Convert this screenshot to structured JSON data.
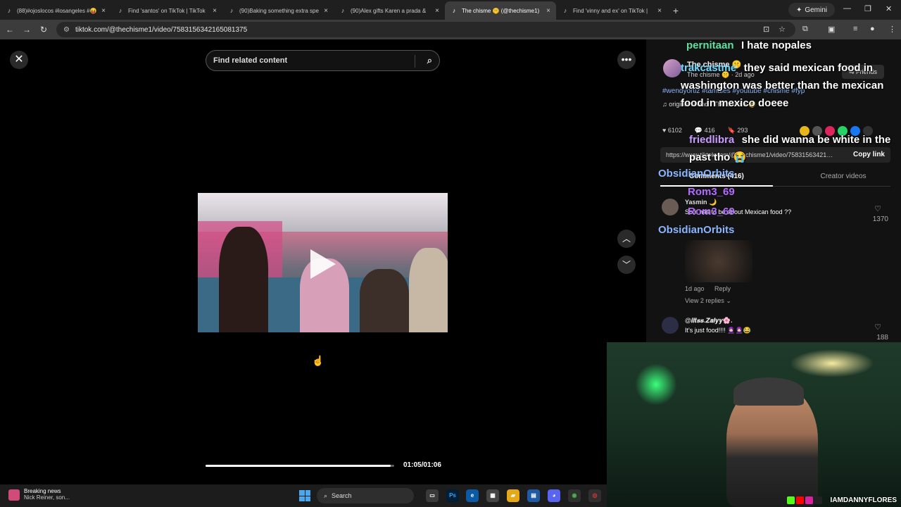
{
  "browser": {
    "tabs": [
      {
        "title": "(88)#ojoslocos #losangeles #😝",
        "active": false
      },
      {
        "title": "Find 'santos' on TikTok | TikTok",
        "active": false
      },
      {
        "title": "(90)Baking something extra spe",
        "active": false
      },
      {
        "title": "(90)Alex gifts Karen a prada &",
        "active": false
      },
      {
        "title": "The chisme 🤫 (@thechisme1)",
        "active": true
      },
      {
        "title": "Find 'vinny and ex' on TikTok |",
        "active": false
      }
    ],
    "new_tab": "+",
    "gemini_label": "Gemini",
    "url": "tiktok.com/@thechisme1/video/7583156342165081375"
  },
  "video": {
    "search_placeholder": "Find related content",
    "progress_percent": 98,
    "time": "01:05/01:06"
  },
  "post": {
    "author": "The chisme 🤫",
    "age": "2d ago",
    "friends_label": "Friends",
    "hashtags": "#wendyortiz #tamales #youtube #chisme #fyp",
    "sound": "original sound - The chisme 🤫",
    "likes": "6102",
    "comments": "416",
    "saves": "293",
    "link": "https://www.tiktok.com/@thechisme1/video/7583156342165081375",
    "copy_link": "Copy link",
    "tab_comments": "Comments (416)",
    "tab_creator": "Creator videos"
  },
  "comments": [
    {
      "user": "Yasmin 🌙",
      "text": "So it has to be about Mexican food ??",
      "likes": "1370",
      "age": "1d ago",
      "reply": "Reply",
      "view_replies": "View 2 replies"
    },
    {
      "user": "@𝒊𝒊𝒕𝒔𝒔.𝒁𝒂𝒍𝒚𝒚🌸.",
      "text": "It's just food!!!! 🧕🏻🧕🏻😂",
      "likes": "188"
    }
  ],
  "overlay_chat": [
    {
      "name": "pernitaan",
      "msg": "I hate nopales",
      "color": "#5fe0a0"
    },
    {
      "name": "trakcastme",
      "msg": "they said mexican food in washington was better than the mexican food in mexico doeee",
      "color": "#6fd8ff"
    },
    {
      "name": "friedlibra",
      "msg": "she did wanna be white in the past tho 😭",
      "color": "#c89bff"
    },
    {
      "name": "ObsidianOrbits",
      "msg": "",
      "color": "#8ab4ff"
    },
    {
      "name": "Rom3_69",
      "msg": "",
      "color": "#b06cff"
    },
    {
      "name": "Rom3_69",
      "msg": "",
      "color": "#b06cff"
    },
    {
      "name": "ObsidianOrbits",
      "msg": "",
      "color": "#8ab4ff"
    }
  ],
  "webcam": {
    "handle": "IAMDANNYFLORES"
  },
  "taskbar": {
    "news_title": "Breaking news",
    "news_sub": "Nick Reiner, son...",
    "search_label": "Search"
  },
  "colors": {
    "accent_link": "#8ab4f8",
    "chrome_dark": "#1f1f1f"
  }
}
